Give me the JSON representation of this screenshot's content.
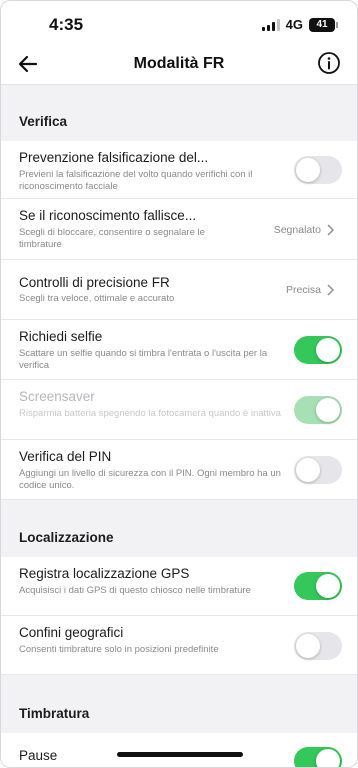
{
  "status_bar": {
    "time": "4:35",
    "network": "4G",
    "battery": "41"
  },
  "nav": {
    "title": "Modalità FR"
  },
  "sections": {
    "verifica": "Verifica",
    "localizzazione": "Localizzazione",
    "timbratura": "Timbratura"
  },
  "rows": {
    "antispoof": {
      "title": "Prevenzione falsificazione del...",
      "subtitle": "Previeni la falsificazione del volto quando verifichi con il riconoscimento facciale",
      "toggle_on": false
    },
    "fallback": {
      "title": "Se il riconoscimento fallisce...",
      "subtitle": "Scegli di bloccare, consentire o segnalare le timbrature",
      "value": "Segnalato"
    },
    "precision": {
      "title": "Controlli di precisione FR",
      "subtitle": "Scegli tra veloce, ottimale e accurato",
      "value": "Precisa"
    },
    "selfie": {
      "title": "Richiedi selfie",
      "subtitle": "Scattare un selfie quando si timbra l'entrata o l'uscita per la verifica",
      "toggle_on": true
    },
    "screensaver": {
      "title": "Screensaver",
      "subtitle": "Risparmia batteria spegnendo la fotocamera quando è inattiva",
      "toggle_on": true,
      "disabled": true
    },
    "pin": {
      "title": "Verifica del PIN",
      "subtitle": "Aggiungi un livello di sicurezza con il PIN. Ogni membro ha un codice unico.",
      "toggle_on": false
    },
    "gps": {
      "title": "Registra localizzazione GPS",
      "subtitle": "Acquisisci i dati GPS di questo chiosco nelle timbrature",
      "toggle_on": true
    },
    "geofence": {
      "title": "Confini geografici",
      "subtitle": "Consenti timbrature solo in posizioni predefinite",
      "toggle_on": false
    },
    "breaks": {
      "title": "Pause",
      "toggle_on": true
    }
  },
  "colors": {
    "toggle_on": "#34c759",
    "toggle_off": "#e6e6ea",
    "background": "#f2f2f4"
  },
  "icons": {
    "back": "arrow-left-icon",
    "info": "info-circle-icon",
    "chevron": "chevron-right-icon"
  }
}
